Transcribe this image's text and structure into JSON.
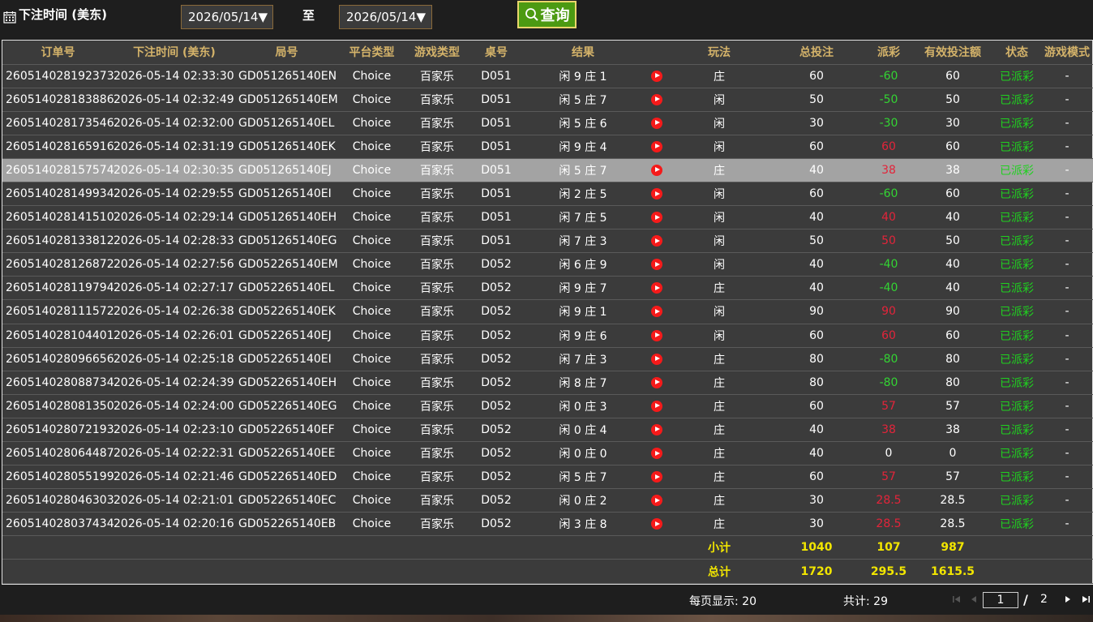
{
  "filter": {
    "label": "下注时间 (美东)",
    "date_from": "2026/05/14▼",
    "range_sep": "至",
    "date_to": "2026/05/14▼",
    "query_label": "查询"
  },
  "table": {
    "headers": [
      "订单号",
      "下注时间 (美东)",
      "局号",
      "平台类型",
      "游戏类型",
      "桌号",
      "结果",
      "",
      "玩法",
      "总投注",
      "派彩",
      "有效投注额",
      "状态",
      "游戏模式"
    ],
    "rows": [
      {
        "order": "260514028192373",
        "time": "2026-05-14 02:33:30",
        "round": "GD051265140EN",
        "platform": "Choice",
        "game": "百家乐",
        "table": "D051",
        "result": "闲 9 庄 1",
        "bet": "庄",
        "total": "60",
        "payout": "-60",
        "valid": "60",
        "status": "已派彩",
        "mode": "-"
      },
      {
        "order": "260514028183886",
        "time": "2026-05-14 02:32:49",
        "round": "GD051265140EM",
        "platform": "Choice",
        "game": "百家乐",
        "table": "D051",
        "result": "闲 5 庄 7",
        "bet": "闲",
        "total": "50",
        "payout": "-50",
        "valid": "50",
        "status": "已派彩",
        "mode": "-"
      },
      {
        "order": "260514028173546",
        "time": "2026-05-14 02:32:00",
        "round": "GD051265140EL",
        "platform": "Choice",
        "game": "百家乐",
        "table": "D051",
        "result": "闲 5 庄 6",
        "bet": "闲",
        "total": "30",
        "payout": "-30",
        "valid": "30",
        "status": "已派彩",
        "mode": "-"
      },
      {
        "order": "260514028165916",
        "time": "2026-05-14 02:31:19",
        "round": "GD051265140EK",
        "platform": "Choice",
        "game": "百家乐",
        "table": "D051",
        "result": "闲 9 庄 4",
        "bet": "闲",
        "total": "60",
        "payout": "60",
        "valid": "60",
        "status": "已派彩",
        "mode": "-"
      },
      {
        "order": "260514028157574",
        "time": "2026-05-14 02:30:35",
        "round": "GD051265140EJ",
        "platform": "Choice",
        "game": "百家乐",
        "table": "D051",
        "result": "闲 5 庄 7",
        "bet": "庄",
        "total": "40",
        "payout": "38",
        "valid": "38",
        "status": "已派彩",
        "mode": "-"
      },
      {
        "order": "260514028149934",
        "time": "2026-05-14 02:29:55",
        "round": "GD051265140EI",
        "platform": "Choice",
        "game": "百家乐",
        "table": "D051",
        "result": "闲 2 庄 5",
        "bet": "闲",
        "total": "60",
        "payout": "-60",
        "valid": "60",
        "status": "已派彩",
        "mode": "-"
      },
      {
        "order": "260514028141510",
        "time": "2026-05-14 02:29:14",
        "round": "GD051265140EH",
        "platform": "Choice",
        "game": "百家乐",
        "table": "D051",
        "result": "闲 7 庄 5",
        "bet": "闲",
        "total": "40",
        "payout": "40",
        "valid": "40",
        "status": "已派彩",
        "mode": "-"
      },
      {
        "order": "260514028133812",
        "time": "2026-05-14 02:28:33",
        "round": "GD051265140EG",
        "platform": "Choice",
        "game": "百家乐",
        "table": "D051",
        "result": "闲 7 庄 3",
        "bet": "闲",
        "total": "50",
        "payout": "50",
        "valid": "50",
        "status": "已派彩",
        "mode": "-"
      },
      {
        "order": "260514028126872",
        "time": "2026-05-14 02:27:56",
        "round": "GD052265140EM",
        "platform": "Choice",
        "game": "百家乐",
        "table": "D052",
        "result": "闲 6 庄 9",
        "bet": "闲",
        "total": "40",
        "payout": "-40",
        "valid": "40",
        "status": "已派彩",
        "mode": "-"
      },
      {
        "order": "260514028119794",
        "time": "2026-05-14 02:27:17",
        "round": "GD052265140EL",
        "platform": "Choice",
        "game": "百家乐",
        "table": "D052",
        "result": "闲 9 庄 7",
        "bet": "庄",
        "total": "40",
        "payout": "-40",
        "valid": "40",
        "status": "已派彩",
        "mode": "-"
      },
      {
        "order": "260514028111572",
        "time": "2026-05-14 02:26:38",
        "round": "GD052265140EK",
        "platform": "Choice",
        "game": "百家乐",
        "table": "D052",
        "result": "闲 9 庄 1",
        "bet": "闲",
        "total": "90",
        "payout": "90",
        "valid": "90",
        "status": "已派彩",
        "mode": "-"
      },
      {
        "order": "260514028104401",
        "time": "2026-05-14 02:26:01",
        "round": "GD052265140EJ",
        "platform": "Choice",
        "game": "百家乐",
        "table": "D052",
        "result": "闲 9 庄 6",
        "bet": "闲",
        "total": "60",
        "payout": "60",
        "valid": "60",
        "status": "已派彩",
        "mode": "-"
      },
      {
        "order": "260514028096656",
        "time": "2026-05-14 02:25:18",
        "round": "GD052265140EI",
        "platform": "Choice",
        "game": "百家乐",
        "table": "D052",
        "result": "闲 7 庄 3",
        "bet": "庄",
        "total": "80",
        "payout": "-80",
        "valid": "80",
        "status": "已派彩",
        "mode": "-"
      },
      {
        "order": "260514028088734",
        "time": "2026-05-14 02:24:39",
        "round": "GD052265140EH",
        "platform": "Choice",
        "game": "百家乐",
        "table": "D052",
        "result": "闲 8 庄 7",
        "bet": "庄",
        "total": "80",
        "payout": "-80",
        "valid": "80",
        "status": "已派彩",
        "mode": "-"
      },
      {
        "order": "260514028081350",
        "time": "2026-05-14 02:24:00",
        "round": "GD052265140EG",
        "platform": "Choice",
        "game": "百家乐",
        "table": "D052",
        "result": "闲 0 庄 3",
        "bet": "庄",
        "total": "60",
        "payout": "57",
        "valid": "57",
        "status": "已派彩",
        "mode": "-"
      },
      {
        "order": "260514028072193",
        "time": "2026-05-14 02:23:10",
        "round": "GD052265140EF",
        "platform": "Choice",
        "game": "百家乐",
        "table": "D052",
        "result": "闲 0 庄 4",
        "bet": "庄",
        "total": "40",
        "payout": "38",
        "valid": "38",
        "status": "已派彩",
        "mode": "-"
      },
      {
        "order": "260514028064487",
        "time": "2026-05-14 02:22:31",
        "round": "GD052265140EE",
        "platform": "Choice",
        "game": "百家乐",
        "table": "D052",
        "result": "闲 0 庄 0",
        "bet": "庄",
        "total": "40",
        "payout": "0",
        "valid": "0",
        "status": "已派彩",
        "mode": "-"
      },
      {
        "order": "260514028055199",
        "time": "2026-05-14 02:21:46",
        "round": "GD052265140ED",
        "platform": "Choice",
        "game": "百家乐",
        "table": "D052",
        "result": "闲 5 庄 7",
        "bet": "庄",
        "total": "60",
        "payout": "57",
        "valid": "57",
        "status": "已派彩",
        "mode": "-"
      },
      {
        "order": "260514028046303",
        "time": "2026-05-14 02:21:01",
        "round": "GD052265140EC",
        "platform": "Choice",
        "game": "百家乐",
        "table": "D052",
        "result": "闲 0 庄 2",
        "bet": "庄",
        "total": "30",
        "payout": "28.5",
        "valid": "28.5",
        "status": "已派彩",
        "mode": "-"
      },
      {
        "order": "260514028037434",
        "time": "2026-05-14 02:20:16",
        "round": "GD052265140EB",
        "platform": "Choice",
        "game": "百家乐",
        "table": "D052",
        "result": "闲 3 庄 8",
        "bet": "庄",
        "total": "30",
        "payout": "28.5",
        "valid": "28.5",
        "status": "已派彩",
        "mode": "-"
      }
    ],
    "subtotal": {
      "label": "小计",
      "total": "1040",
      "payout": "107",
      "valid": "987"
    },
    "grandtotal": {
      "label": "总计",
      "total": "1720",
      "payout": "295.5",
      "valid": "1615.5"
    }
  },
  "pager": {
    "per_page": "每页显示: 20",
    "total": "共计: 29",
    "current_page": "1",
    "sep": "/",
    "total_pages": "2"
  },
  "colors": {
    "header_text": "#d4b36a",
    "win": "#e3243a",
    "loss": "#33d433",
    "status": "#1fd11f",
    "sum": "#f2e600",
    "highlight_row": "#a3a3a3"
  }
}
